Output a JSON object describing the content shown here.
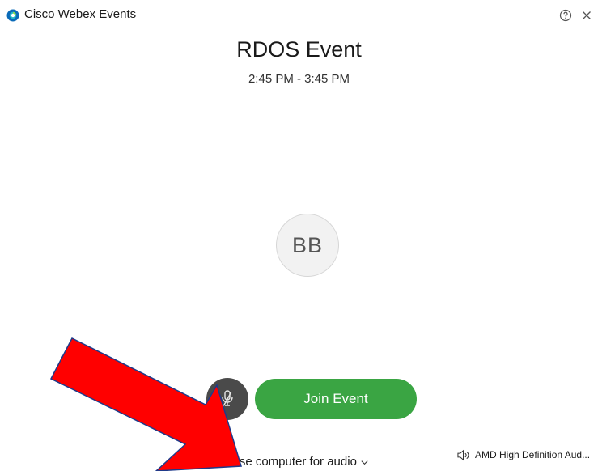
{
  "window": {
    "app_title": "Cisco Webex Events",
    "help_icon": "question-circle-icon",
    "close_icon": "close-icon"
  },
  "event": {
    "title": "RDOS Event",
    "time": "2:45 PM - 3:45 PM"
  },
  "participant": {
    "initials": "BB"
  },
  "controls": {
    "mute_icon": "microphone-muted-icon",
    "join_label": "Join Event",
    "join_color": "#3aa543",
    "mute_color": "#4a4a4a"
  },
  "audio": {
    "connection_label": "Use computer for audio",
    "speaker_label": "AMD High Definition Aud..."
  },
  "annotation": {
    "arrow_color": "#ff0000"
  }
}
